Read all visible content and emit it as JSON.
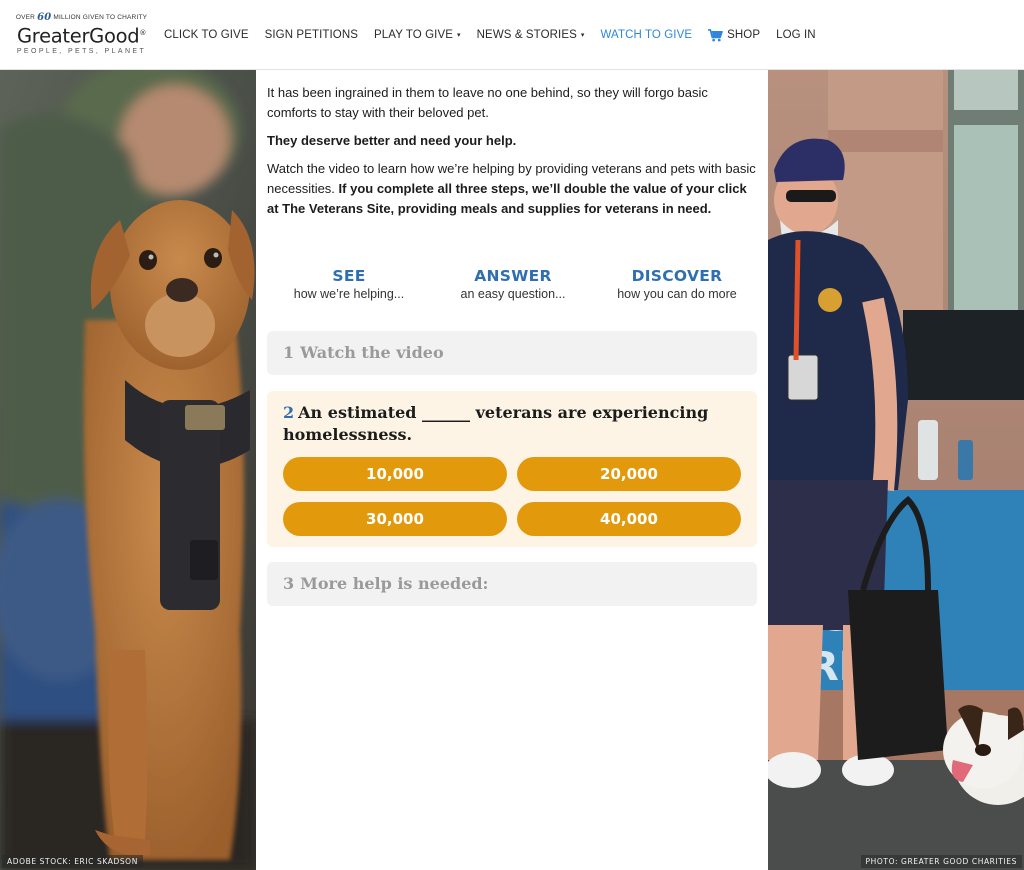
{
  "header": {
    "logo": {
      "tagline_over": "OVER",
      "tagline_number": "60",
      "tagline_rest": "MILLION GIVEN TO CHARITY",
      "wordmark": "GreaterGood",
      "registered": "®",
      "subline": "PEOPLE, PETS, PLANET"
    },
    "nav": [
      {
        "label": "CLICK TO GIVE",
        "dropdown": false
      },
      {
        "label": "SIGN PETITIONS",
        "dropdown": false
      },
      {
        "label": "PLAY TO GIVE",
        "dropdown": true
      },
      {
        "label": "NEWS & STORIES",
        "dropdown": true
      },
      {
        "label": "WATCH TO GIVE",
        "dropdown": false,
        "active": true
      },
      {
        "label": "SHOP",
        "dropdown": false,
        "icon": "cart-icon"
      },
      {
        "label": "LOG IN",
        "dropdown": false
      }
    ],
    "caret": "▾"
  },
  "content": {
    "para1": "It has been ingrained in them to leave no one behind, so they will forgo basic comforts to stay with their beloved pet.",
    "para2": "They deserve better and need your help.",
    "para3_normal": "Watch the video to learn how we’re helping by providing veterans and pets with basic necessities. ",
    "para3_bold": "If you complete all three steps, we’ll double the value of your click at The Veterans Site, providing meals and supplies for veterans in need.",
    "steps": [
      {
        "title": "SEE",
        "sub": "how we’re helping..."
      },
      {
        "title": "ANSWER",
        "sub": "an easy question..."
      },
      {
        "title": "DISCOVER",
        "sub": "how you can do more"
      }
    ],
    "step1": {
      "num": "1",
      "title": "Watch the video"
    },
    "step2": {
      "num": "2",
      "question": "An estimated ______ veterans are experiencing homelessness.",
      "answers": [
        "10,000",
        "20,000",
        "30,000",
        "40,000"
      ]
    },
    "step3": {
      "num": "3",
      "title": "More help is needed:"
    }
  },
  "photos": {
    "left_credit": "ADOBE STOCK: ERIC SKADSON",
    "right_credit": "PHOTO: GREATER GOOD CHARITIES"
  },
  "colors": {
    "accent_blue": "#2f6fb0",
    "nav_active": "#2e86de",
    "answer_button": "#e29a0c",
    "active_card": "#fdf4e5",
    "inactive_card": "#f2f2f2"
  }
}
